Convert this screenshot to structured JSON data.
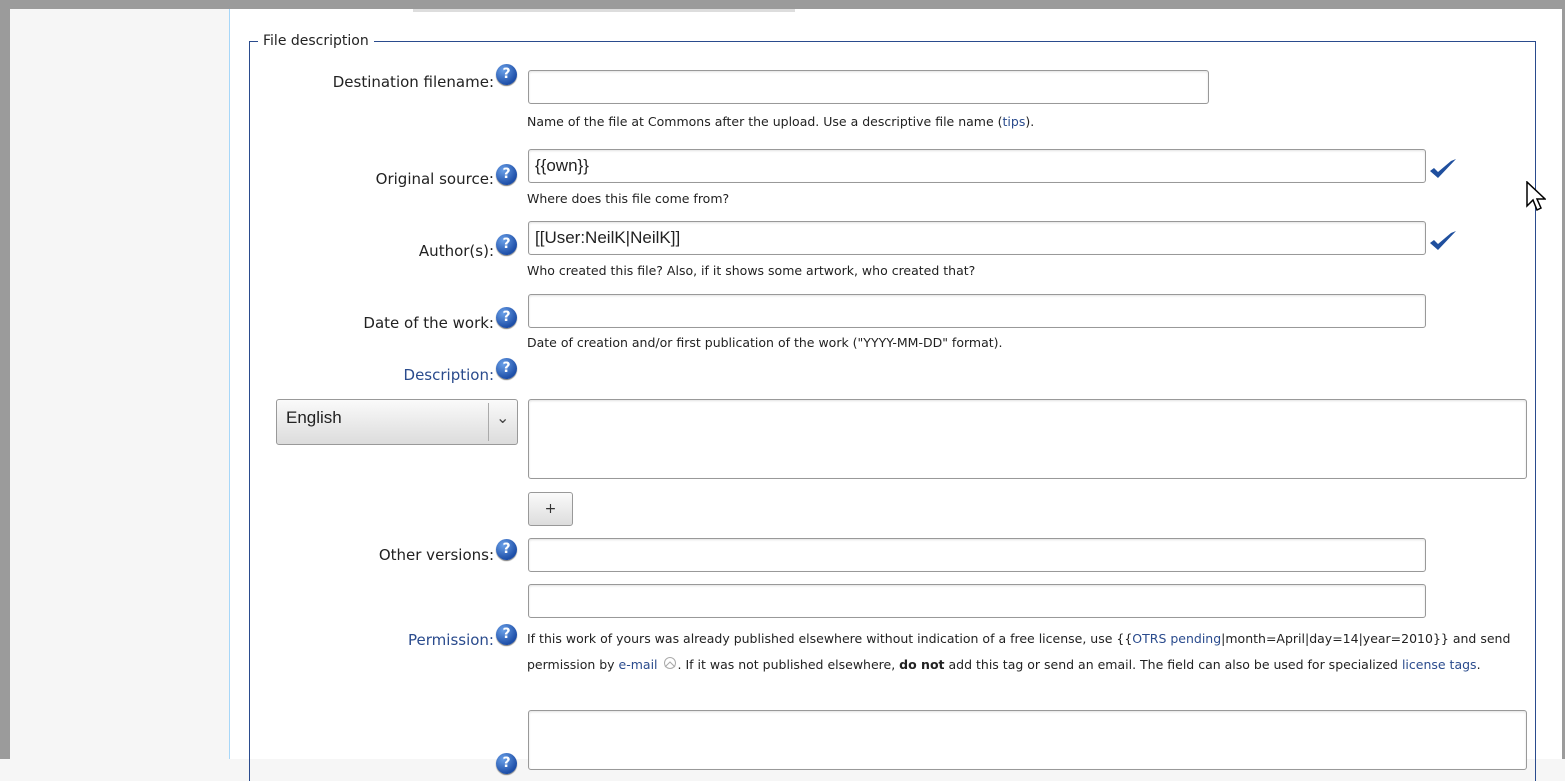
{
  "form": {
    "legend": "File description",
    "destination": {
      "label": "Destination filename:",
      "value": "",
      "hint_before": "Name of the file at Commons after the upload. Use a descriptive file name (",
      "hint_link": "tips",
      "hint_after": ")."
    },
    "source": {
      "label": "Original source:",
      "value": "{{own}}",
      "hint": "Where does this file come from?"
    },
    "author": {
      "label": "Author(s):",
      "value": "[[User:NeilK|NeilK]]",
      "hint": "Who created this file? Also, if it shows some artwork, who created that?"
    },
    "date": {
      "label": "Date of the work:",
      "value": "",
      "hint": "Date of creation and/or first publication of the work (\"YYYY-MM-DD\" format)."
    },
    "description": {
      "label": "Description:",
      "language": "English",
      "value": "",
      "add_label": "+"
    },
    "other_versions": {
      "label": "Other versions:",
      "value1": "",
      "value2": ""
    },
    "permission": {
      "label": "Permission:",
      "text1": "If this work of yours was already published elsewhere without indication of a free license, use {{",
      "link1": "OTRS pending",
      "text2": "|month=April|day=14|year=2010}} and send permission by ",
      "link2": "e-mail",
      "text3": ". If it was not published elsewhere, ",
      "bold": "do not",
      "text4": " add this tag or send an email. The field can also be used for specialized ",
      "link3": "license tags",
      "text5": ".",
      "value": ""
    },
    "help_glyph": "?"
  },
  "colors": {
    "link": "#2a4b8d",
    "help_icon": "#1e4fa8"
  }
}
